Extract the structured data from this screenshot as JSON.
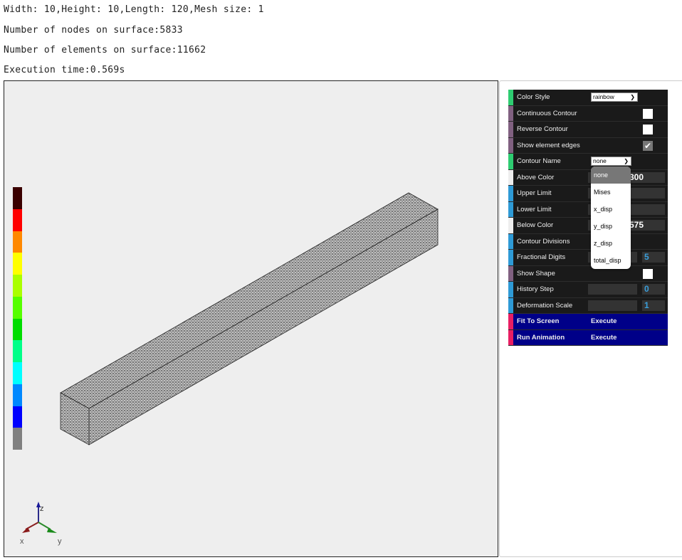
{
  "info": {
    "dimensions": "Width: 10,Height: 10,Length: 120,Mesh size: 1",
    "nodes": "Number of nodes on surface:5833",
    "elements": "Number of elements on surface:11662",
    "time": "Execution time:0.569s"
  },
  "colorbar": [
    "#3a0000",
    "#ff0000",
    "#ff8800",
    "#ffff00",
    "#aaff00",
    "#55ff00",
    "#00dd00",
    "#00ff88",
    "#00ffff",
    "#0088ff",
    "#0000ff",
    "#808080"
  ],
  "axes": {
    "x": "x",
    "y": "y",
    "z": "z"
  },
  "panel": {
    "color_style": {
      "label": "Color Style",
      "value": "rainbow"
    },
    "continuous_contour": {
      "label": "Continuous Contour",
      "checked": false
    },
    "reverse_contour": {
      "label": "Reverse Contour",
      "checked": false
    },
    "show_edges": {
      "label": "Show element edges",
      "checked": true
    },
    "contour_name": {
      "label": "Contour Name",
      "value": "none"
    },
    "above_color": {
      "label": "Above Color",
      "value": "300"
    },
    "upper_limit": {
      "label": "Upper Limit"
    },
    "lower_limit": {
      "label": "Lower Limit"
    },
    "below_color": {
      "label": "Below Color",
      "value": "575"
    },
    "contour_divisions": {
      "label": "Contour Divisions"
    },
    "fractional_digits": {
      "label": "Fractional Digits",
      "value": "5"
    },
    "show_shape": {
      "label": "Show Shape",
      "checked": false
    },
    "history_step": {
      "label": "History Step",
      "value": "0"
    },
    "deformation_scale": {
      "label": "Deformation Scale",
      "value": "1"
    },
    "fit_to_screen": {
      "label": "Fit To Screen",
      "action": "Execute"
    },
    "run_animation": {
      "label": "Run Animation",
      "action": "Execute"
    }
  },
  "dropdown_options": [
    "none",
    "Mises",
    "x_disp",
    "y_disp",
    "z_disp",
    "total_disp"
  ]
}
